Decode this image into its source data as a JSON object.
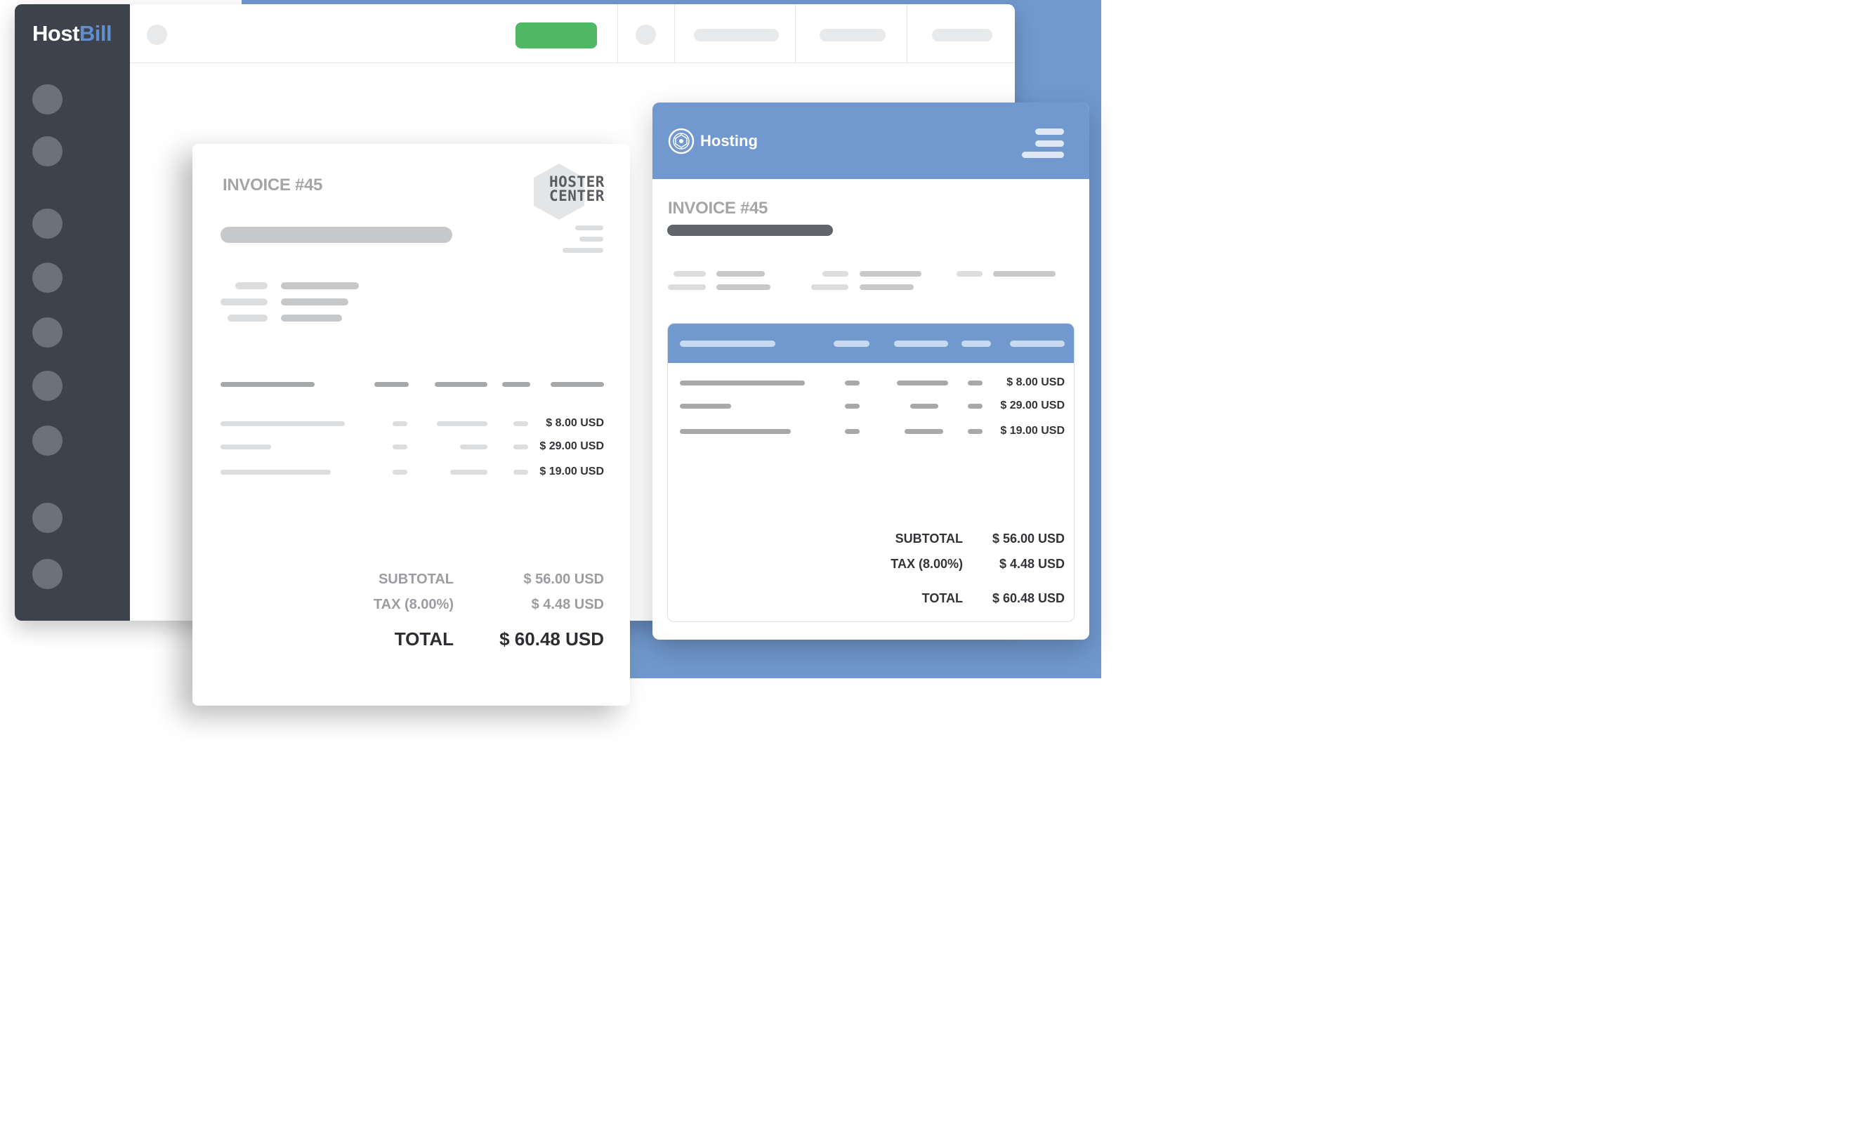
{
  "app": {
    "logo_host": "Host",
    "logo_bill": "Bill"
  },
  "invoice_left": {
    "title": "INVOICE #45",
    "brand_line1": "HOSTER",
    "brand_line2": "CENTER",
    "line_amounts": [
      "$ 8.00 USD",
      "$ 29.00 USD",
      "$ 19.00 USD"
    ],
    "subtotal_label": "SUBTOTAL",
    "subtotal_value": "$ 56.00 USD",
    "tax_label": "TAX (8.00%)",
    "tax_value": "$ 4.48 USD",
    "total_label": "TOTAL",
    "total_value": "$ 60.48 USD"
  },
  "invoice_right": {
    "header_title": "Hosting",
    "title": "INVOICE #45",
    "line_amounts": [
      "$ 8.00 USD",
      "$ 29.00 USD",
      "$ 19.00 USD"
    ],
    "subtotal_label": "SUBTOTAL",
    "subtotal_value": "$ 56.00 USD",
    "tax_label": "TAX (8.00%)",
    "tax_value": "$ 4.48 USD",
    "total_label": "TOTAL",
    "total_value": "$ 60.48 USD"
  },
  "icons": [
    "menu-icon",
    "hosting-logo-icon",
    "hoster-center-logo"
  ],
  "colors": {
    "accent_blue": "#7199cf",
    "sidebar": "#3d424c",
    "action_green": "#4fb864"
  }
}
